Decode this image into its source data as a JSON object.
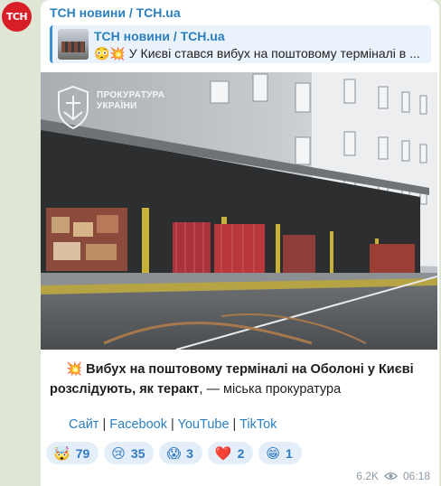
{
  "channel": {
    "avatar_text": "ТСН",
    "name": "ТСН новини / TCH.ua"
  },
  "reply": {
    "title": "ТСН новини / TCH.ua",
    "text": "😳💥 У Києві стався вибух на поштовому терміналі в ..."
  },
  "photo": {
    "logo_line1": "ПРОКУРАТУРА",
    "logo_line2": "УКРАЇНИ"
  },
  "caption": {
    "emoji": "💥",
    "bold": "Вибух на поштовому терміналі на Оболоні у Києві розслідують, як теракт",
    "rest": ", — міська прокуратура"
  },
  "links": {
    "site": "Сайт",
    "sep1": " | ",
    "facebook": "Facebook",
    "sep2": " | ",
    "youtube": "YouTube",
    "sep3": " | ",
    "tiktok": "TikTok"
  },
  "reactions": [
    {
      "emoji": "🤯",
      "count": "79"
    },
    {
      "emoji": "😢",
      "count": "35"
    },
    {
      "emoji": "😱",
      "count": "3"
    },
    {
      "emoji": "❤️",
      "count": "2"
    },
    {
      "emoji": "😁",
      "count": "1"
    }
  ],
  "meta": {
    "views": "6.2K",
    "time": "06:18"
  },
  "colors": {
    "accent": "#2a7fbf",
    "avatar_bg": "#d81e26",
    "chat_bg": "#dfe6d6"
  }
}
